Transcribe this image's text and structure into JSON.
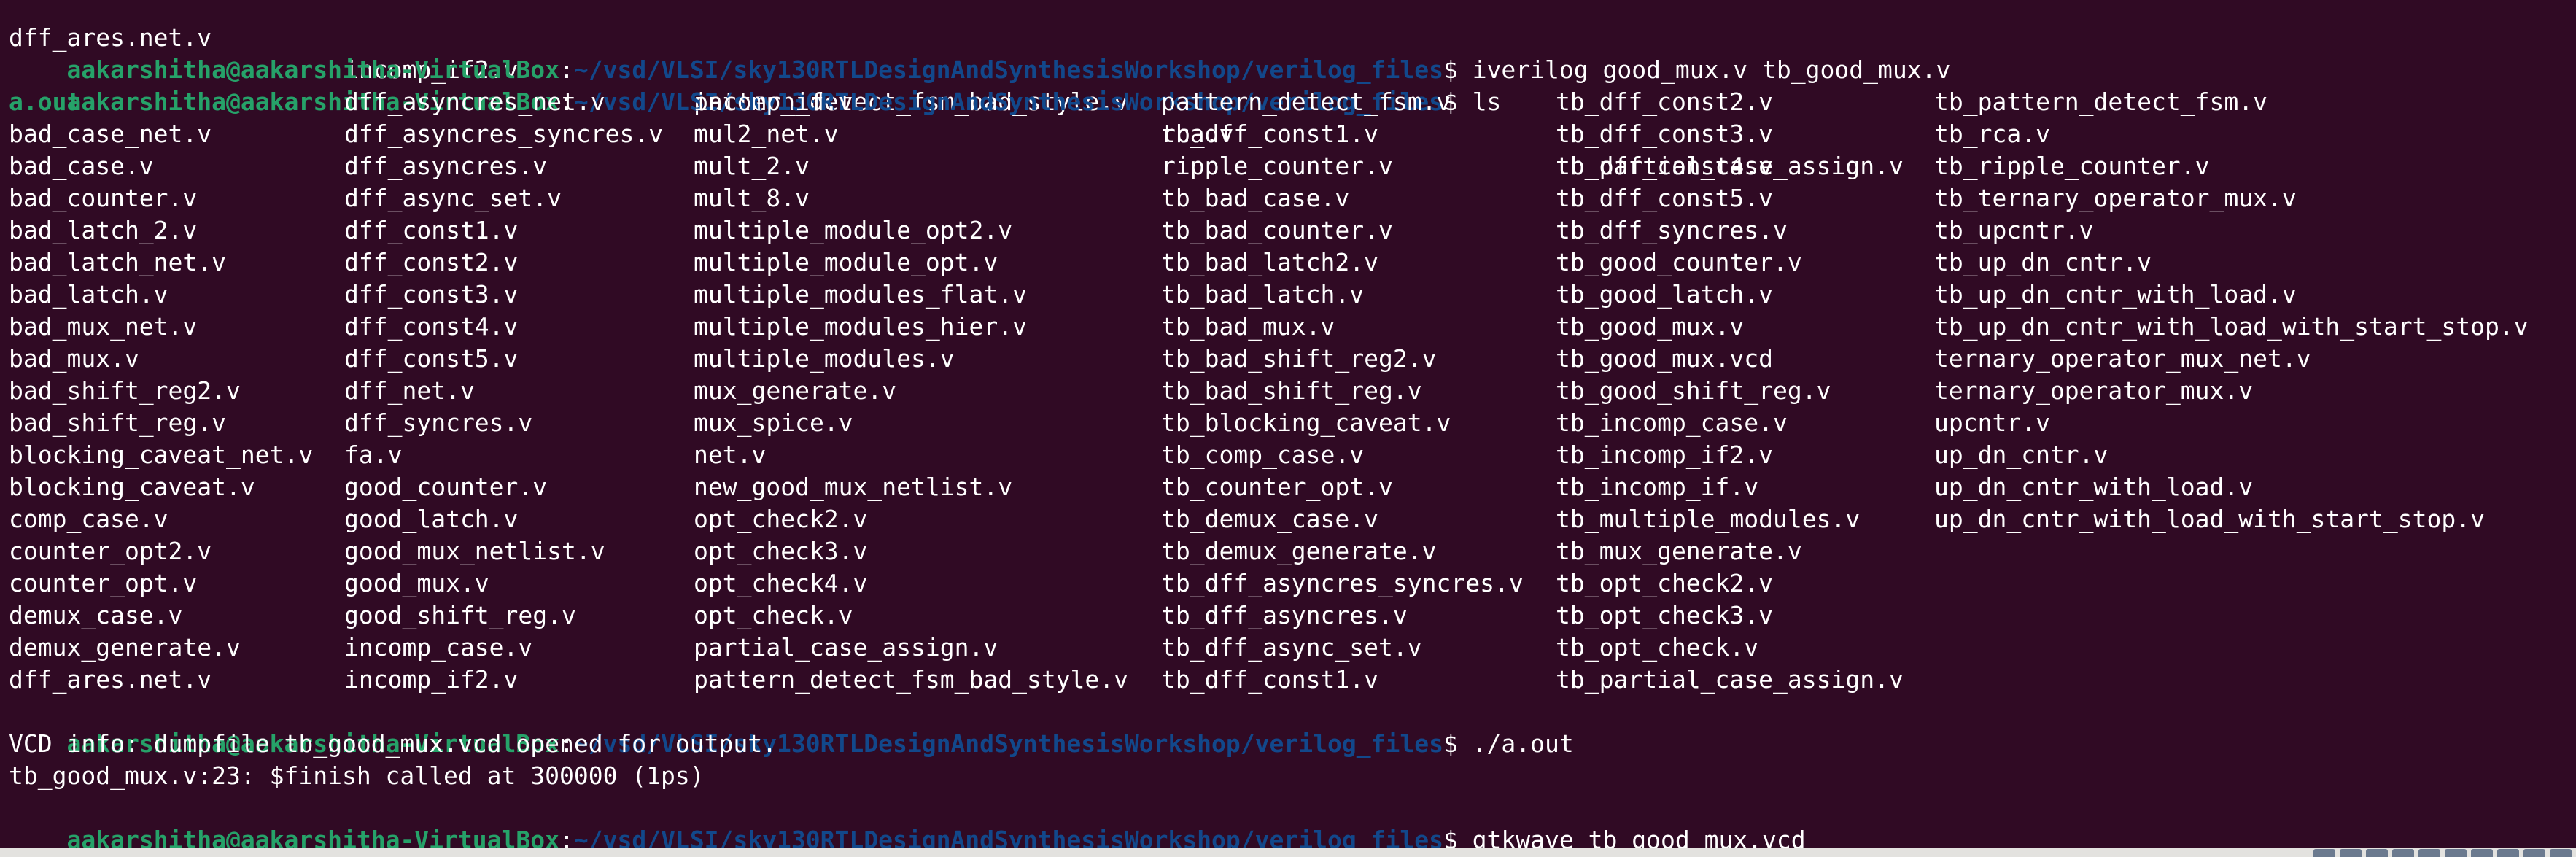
{
  "terminal": {
    "user_host": "aakarshitha@aakarshitha-VirtualBox",
    "cwd": "~/vsd/VLSI/sky130RTLDesignAndSynthesisWorkshop/verilog_files",
    "prompt_symbol": "$",
    "first_row": [
      "dff_ares.net.v",
      "incomp_if2.v",
      "pattern_detect_fsm_bad_style.v",
      "tb_dff_const1.v",
      "tb_partial_case_assign.v"
    ],
    "cmd1": "iverilog good_mux.v tb_good_mux.v",
    "cmd2": "ls",
    "ls_columns": [
      [
        "a.out",
        "bad_case_net.v",
        "bad_case.v",
        "bad_counter.v",
        "bad_latch_2.v",
        "bad_latch_net.v",
        "bad_latch.v",
        "bad_mux_net.v",
        "bad_mux.v",
        "bad_shift_reg2.v",
        "bad_shift_reg.v",
        "blocking_caveat_net.v",
        "blocking_caveat.v",
        "comp_case.v",
        "counter_opt2.v",
        "counter_opt.v",
        "demux_case.v",
        "demux_generate.v",
        "dff_ares.net.v"
      ],
      [
        "dff_asyncres_net.v",
        "dff_asyncres_syncres.v",
        "dff_asyncres.v",
        "dff_async_set.v",
        "dff_const1.v",
        "dff_const2.v",
        "dff_const3.v",
        "dff_const4.v",
        "dff_const5.v",
        "dff_net.v",
        "dff_syncres.v",
        "fa.v",
        "good_counter.v",
        "good_latch.v",
        "good_mux_netlist.v",
        "good_mux.v",
        "good_shift_reg.v",
        "incomp_case.v",
        "incomp_if2.v"
      ],
      [
        "incomp_if.v",
        "mul2_net.v",
        "mult_2.v",
        "mult_8.v",
        "multiple_module_opt2.v",
        "multiple_module_opt.v",
        "multiple_modules_flat.v",
        "multiple_modules_hier.v",
        "multiple_modules.v",
        "mux_generate.v",
        "mux_spice.v",
        "net.v",
        "new_good_mux_netlist.v",
        "opt_check2.v",
        "opt_check3.v",
        "opt_check4.v",
        "opt_check.v",
        "partial_case_assign.v",
        "pattern_detect_fsm_bad_style.v"
      ],
      [
        "pattern_detect_fsm.v",
        "rca.v",
        "ripple_counter.v",
        "tb_bad_case.v",
        "tb_bad_counter.v",
        "tb_bad_latch2.v",
        "tb_bad_latch.v",
        "tb_bad_mux.v",
        "tb_bad_shift_reg2.v",
        "tb_bad_shift_reg.v",
        "tb_blocking_caveat.v",
        "tb_comp_case.v",
        "tb_counter_opt.v",
        "tb_demux_case.v",
        "tb_demux_generate.v",
        "tb_dff_asyncres_syncres.v",
        "tb_dff_asyncres.v",
        "tb_dff_async_set.v",
        "tb_dff_const1.v"
      ],
      [
        "tb_dff_const2.v",
        "tb_dff_const3.v",
        "tb_dff_const4.v",
        "tb_dff_const5.v",
        "tb_dff_syncres.v",
        "tb_good_counter.v",
        "tb_good_latch.v",
        "tb_good_mux.v",
        "tb_good_mux.vcd",
        "tb_good_shift_reg.v",
        "tb_incomp_case.v",
        "tb_incomp_if2.v",
        "tb_incomp_if.v",
        "tb_multiple_modules.v",
        "tb_mux_generate.v",
        "tb_opt_check2.v",
        "tb_opt_check3.v",
        "tb_opt_check.v",
        "tb_partial_case_assign.v"
      ],
      [
        "tb_pattern_detect_fsm.v",
        "tb_rca.v",
        "tb_ripple_counter.v",
        "tb_ternary_operator_mux.v",
        "tb_upcntr.v",
        "tb_up_dn_cntr.v",
        "tb_up_dn_cntr_with_load.v",
        "tb_up_dn_cntr_with_load_with_start_stop.v",
        "ternary_operator_mux_net.v",
        "ternary_operator_mux.v",
        "upcntr.v",
        "up_dn_cntr.v",
        "up_dn_cntr_with_load.v",
        "up_dn_cntr_with_load_with_start_stop.v"
      ]
    ],
    "cmd3": "./a.out",
    "output": [
      "VCD info: dumpfile tb_good_mux.vcd opened for output.",
      "tb_good_mux.v:23: $finish called at 300000 (1ps)"
    ],
    "cmd4": "gtkwave tb_good_mux.vcd"
  },
  "colors": {
    "background": "#300a24",
    "user_host": "#26a269",
    "path": "#12488b",
    "text": "#ffffff",
    "executable": "#26a269"
  },
  "tray_icons": [
    "network-icon",
    "disk-icon",
    "display-icon",
    "usb-icon",
    "folder-icon",
    "audio-icon",
    "window-icon",
    "record-icon",
    "mouse-icon",
    "keyboard-icon"
  ]
}
